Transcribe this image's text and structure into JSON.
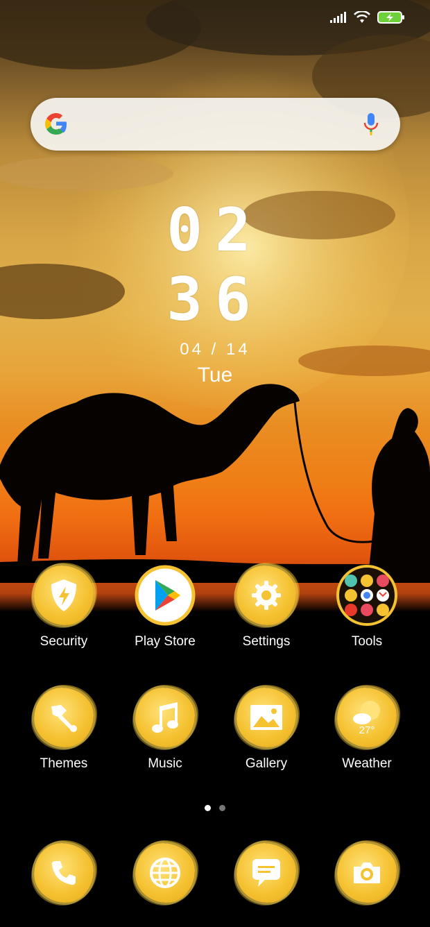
{
  "status_bar": {
    "icons": [
      "signal-icon",
      "wifi-icon",
      "battery-charging-icon"
    ]
  },
  "search_widget": {
    "logo": "google-logo",
    "mic": "mic-icon"
  },
  "clock": {
    "hours": "02",
    "minutes": "36",
    "date": "04 / 14",
    "day": "Tue"
  },
  "apps": [
    {
      "label": "Security",
      "icon": "shield-bolt-icon"
    },
    {
      "label": "Play Store",
      "icon": "play-store-icon"
    },
    {
      "label": "Settings",
      "icon": "gear-icon"
    },
    {
      "label": "Tools",
      "icon": "tools-folder-icon"
    },
    {
      "label": "Themes",
      "icon": "paintbrush-icon"
    },
    {
      "label": "Music",
      "icon": "music-note-icon"
    },
    {
      "label": "Gallery",
      "icon": "image-icon"
    },
    {
      "label": "Weather",
      "icon": "sun-cloud-icon",
      "temp": "27°"
    }
  ],
  "page_indicator": {
    "pages": 2,
    "current": 1
  },
  "dock": [
    {
      "icon": "phone-icon"
    },
    {
      "icon": "globe-icon"
    },
    {
      "icon": "message-icon"
    },
    {
      "icon": "camera-icon"
    }
  ],
  "colors": {
    "icon_yellow": "#f5c232",
    "sunset_orange": "#f07014"
  }
}
